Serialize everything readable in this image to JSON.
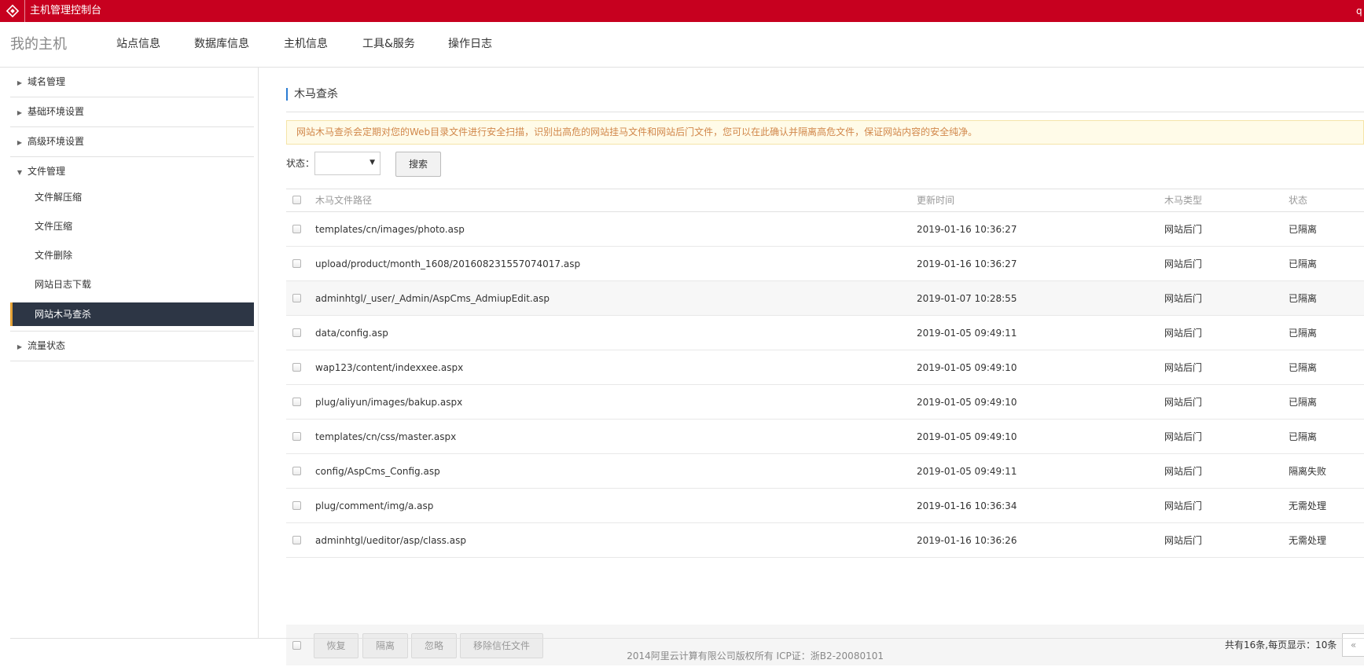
{
  "topbar": {
    "title": "主机管理控制台",
    "user_initial": "q"
  },
  "nav": {
    "brand": "我的主机",
    "items": [
      "站点信息",
      "数据库信息",
      "主机信息",
      "工具&服务",
      "操作日志"
    ]
  },
  "sidebar": {
    "groups": [
      {
        "label": "域名管理"
      },
      {
        "label": "基础环境设置"
      },
      {
        "label": "高级环境设置"
      },
      {
        "label": "文件管理"
      },
      {
        "label": "流量状态"
      }
    ],
    "file_items": [
      "文件解压缩",
      "文件压缩",
      "文件删除",
      "网站日志下载",
      "网站木马查杀"
    ]
  },
  "main": {
    "title": "木马查杀",
    "notice": "网站木马查杀会定期对您的Web目录文件进行安全扫描，识别出高危的网站挂马文件和网站后门文件，您可以在此确认并隔离高危文件，保证网站内容的安全纯净。",
    "filter": {
      "label": "状态：",
      "selected": "",
      "search_label": "搜索"
    },
    "table": {
      "headers": [
        "木马文件路径",
        "更新时间",
        "木马类型",
        "状态"
      ],
      "rows": [
        {
          "path": "templates/cn/images/photo.asp",
          "time": "2019-01-16 10:36:27",
          "type": "网站后门",
          "status": "已隔离"
        },
        {
          "path": "upload/product/month_1608/201608231557074017.asp",
          "time": "2019-01-16 10:36:27",
          "type": "网站后门",
          "status": "已隔离"
        },
        {
          "path": "adminhtgl/_user/_Admin/AspCms_AdmiupEdit.asp",
          "time": "2019-01-07 10:28:55",
          "type": "网站后门",
          "status": "已隔离"
        },
        {
          "path": "data/config.asp",
          "time": "2019-01-05 09:49:11",
          "type": "网站后门",
          "status": "已隔离"
        },
        {
          "path": "wap123/content/indexxee.aspx",
          "time": "2019-01-05 09:49:10",
          "type": "网站后门",
          "status": "已隔离"
        },
        {
          "path": "plug/aliyun/images/bakup.aspx",
          "time": "2019-01-05 09:49:10",
          "type": "网站后门",
          "status": "已隔离"
        },
        {
          "path": "templates/cn/css/master.aspx",
          "time": "2019-01-05 09:49:10",
          "type": "网站后门",
          "status": "已隔离"
        },
        {
          "path": "config/AspCms_Config.asp",
          "time": "2019-01-05 09:49:11",
          "type": "网站后门",
          "status": "隔离失败"
        },
        {
          "path": "plug/comment/img/a.asp",
          "time": "2019-01-16 10:36:34",
          "type": "网站后门",
          "status": "无需处理"
        },
        {
          "path": "adminhtgl/ueditor/asp/class.asp",
          "time": "2019-01-16 10:36:26",
          "type": "网站后门",
          "status": "无需处理"
        }
      ]
    },
    "actions": [
      "恢复",
      "隔离",
      "忽略",
      "移除信任文件"
    ],
    "pagination": {
      "info": "共有16条,每页显示：10条",
      "prev": "«"
    }
  },
  "footer": {
    "text": "2014阿里云计算有限公司版权所有 ICP证：浙B2-20080101"
  },
  "colors": {
    "topbar": "#c7001f",
    "active_item_bg": "#2d3645",
    "active_item_accent": "#e5a236",
    "title_accent": "#2b7cd3",
    "notice_text": "#d1874a"
  },
  "icons": {
    "logo": "aliyun-logo-icon",
    "expand": "caret-right-icon",
    "collapse": "caret-down-icon",
    "select": "caret-down-icon"
  }
}
